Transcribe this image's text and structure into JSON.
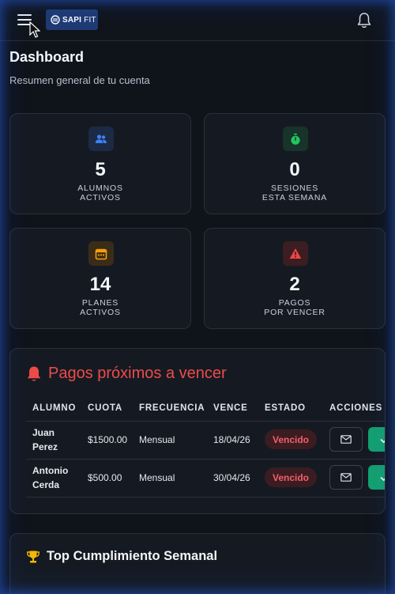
{
  "header": {
    "logo_brand": "SAPI",
    "logo_suffix": "FIT"
  },
  "page": {
    "title": "Dashboard",
    "subtitle": "Resumen general de tu cuenta"
  },
  "stats": [
    {
      "value": "5",
      "label_line1": "ALUMNOS",
      "label_line2": "ACTIVOS",
      "icon": "users-icon",
      "color": "#3b82f6"
    },
    {
      "value": "0",
      "label_line1": "SESIONES",
      "label_line2": "ESTA SEMANA",
      "icon": "stopwatch-icon",
      "color": "#22c55e"
    },
    {
      "value": "14",
      "label_line1": "PLANES",
      "label_line2": "ACTIVOS",
      "icon": "calendar-icon",
      "color": "#f59e0b"
    },
    {
      "value": "2",
      "label_line1": "PAGOS",
      "label_line2": "POR VENCER",
      "icon": "warning-icon",
      "color": "#ef4444"
    }
  ],
  "payments": {
    "title": "Pagos próximos a vencer",
    "columns": [
      "ALUMNO",
      "CUOTA",
      "FRECUENCIA",
      "VENCE",
      "ESTADO",
      "ACCIONES"
    ],
    "rows": [
      {
        "name_line1": "Juan",
        "name_line2": "Perez",
        "cuota": "$1500.00",
        "frecuencia": "Mensual",
        "vence": "18/04/26",
        "estado": "Vencido"
      },
      {
        "name_line1": "Antonio",
        "name_line2": "Cerda",
        "cuota": "$500.00",
        "frecuencia": "Mensual",
        "vence": "30/04/26",
        "estado": "Vencido"
      }
    ]
  },
  "ranking": {
    "title": "Top Cumplimiento Semanal"
  },
  "colors": {
    "accent_red": "#ef4a4a",
    "success": "#14a06f",
    "logo_bg": "#1f3a73"
  }
}
